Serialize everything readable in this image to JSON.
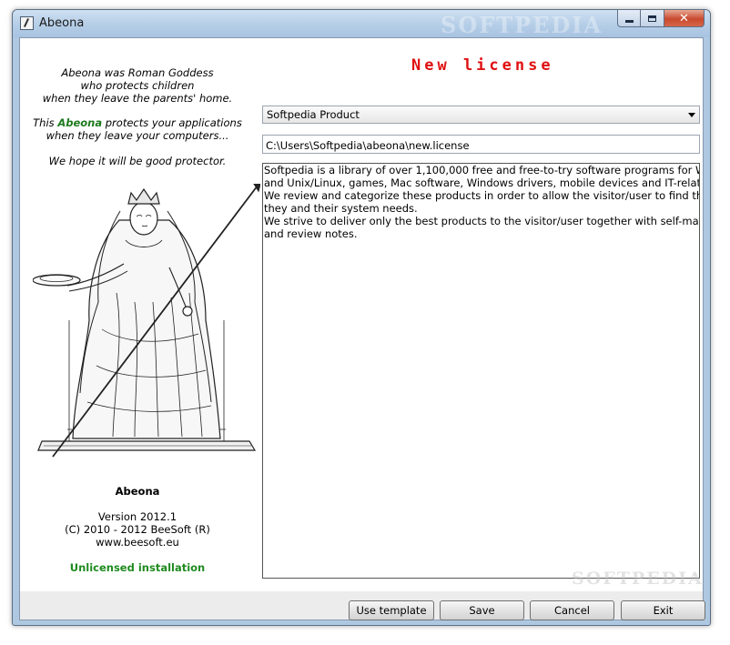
{
  "window": {
    "title": "Abeona",
    "icon": "app-icon",
    "watermark": "SOFTPEDIA"
  },
  "intro": {
    "line1": "Abeona was Roman Goddess",
    "line2": "who protects children",
    "line3": "when they leave the parents' home.",
    "line4_pre": "This ",
    "line4_accent": "Abeona",
    "line4_post": " protects your applications",
    "line5": "when they leave your computers...",
    "line6": "We hope it will be good protector."
  },
  "about": {
    "app_name": "Abeona",
    "version": "Version 2012.1",
    "copyright": "(C) 2010 - 2012 BeeSoft (R)",
    "website": "www.beesoft.eu",
    "license_status": "Unlicensed installation"
  },
  "form": {
    "heading": "New license",
    "product": "Softpedia Product",
    "path": "C:\\Users\\Softpedia\\abeona\\new.license",
    "description_lines": [
      "Softpedia is a library of over 1,100,000 free and free-to-try software programs for Windows",
      "and Unix/Linux, games, Mac software, Windows drivers, mobile devices and IT-related articles.",
      "We review and categorize these products in order to allow the visitor/user to find the exact product",
      "they and their system needs.",
      "We strive to deliver only the best products to the visitor/user together with self-made evaluation",
      "and review notes."
    ],
    "watermark": "SOFTPEDIA"
  },
  "buttons": {
    "use_template": "Use template",
    "save": "Save",
    "cancel": "Cancel",
    "exit": "Exit"
  },
  "colors": {
    "heading": "#e01010",
    "accent": "#1e7a1e",
    "license_status": "#1f8b1f"
  }
}
